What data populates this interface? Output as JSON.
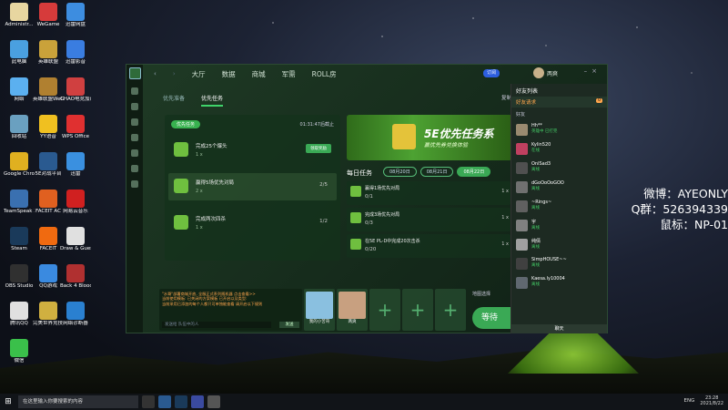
{
  "desktop_icons": [
    {
      "label": "Administr...",
      "color": "#e8d6a0"
    },
    {
      "label": "WeGame",
      "color": "#d63b3b"
    },
    {
      "label": "迅雷网盘",
      "color": "#3d8de0"
    },
    {
      "label": "此电脑",
      "color": "#4aa0e0"
    },
    {
      "label": "英雄联盟",
      "color": "#caa23a"
    },
    {
      "label": "迅雷影音",
      "color": "#3a7de0"
    },
    {
      "label": "网络",
      "color": "#5bb0f0"
    },
    {
      "label": "英雄联盟WeGame版",
      "color": "#b08030"
    },
    {
      "label": "CHAO电竞加速器",
      "color": "#d04040"
    },
    {
      "label": "回收站",
      "color": "#6aa0c0"
    },
    {
      "label": "YY语音",
      "color": "#f0c020"
    },
    {
      "label": "WPS Office",
      "color": "#e03030"
    },
    {
      "label": "Google Chrome",
      "color": "#e0b020"
    },
    {
      "label": "5E对战平台",
      "color": "#2a5a90"
    },
    {
      "label": "迅雷",
      "color": "#3a90e0"
    },
    {
      "label": "TeamSpeak 3",
      "color": "#3a70b0"
    },
    {
      "label": "FACEIT AC",
      "color": "#e06020"
    },
    {
      "label": "网易云音乐",
      "color": "#d02020"
    },
    {
      "label": "Steam",
      "color": "#1a3a5a"
    },
    {
      "label": "FACEIT",
      "color": "#f06a10"
    },
    {
      "label": "Draw & Guess",
      "color": "#e0e0e0"
    },
    {
      "label": "OBS Studio",
      "color": "#303030"
    },
    {
      "label": "QQ游戏",
      "color": "#3a8ae0"
    },
    {
      "label": "Back 4 Blood Beta",
      "color": "#b03030"
    },
    {
      "label": "腾讯QQ",
      "color": "#e0e0e0"
    },
    {
      "label": "完美世界竞技平台",
      "color": "#d0b040"
    },
    {
      "label": "网络诊断器",
      "color": "#2a80d0"
    },
    {
      "label": "微信",
      "color": "#3ac04a"
    }
  ],
  "app": {
    "nav": [
      "大厅",
      "数据",
      "商城",
      "军需",
      "ROLL房"
    ],
    "notify_btn": "订阅",
    "username": "两爽",
    "subtabs": [
      "优先准备",
      "优先任务"
    ],
    "copy_link": "复制房间",
    "priority": {
      "label": "优先任务",
      "deadline": "01:31:47后截止",
      "tasks": [
        {
          "name": "完成25个爆头",
          "reward": "1 x",
          "action": "领取奖励"
        },
        {
          "name": "赢得5场优先对局",
          "reward": "2 x",
          "progress": "2/5"
        },
        {
          "name": "完成两次四杀",
          "reward": "1 x",
          "progress": "1/2"
        }
      ]
    },
    "banner": {
      "title": "5E优先任务系",
      "subtitle": "赢优先券兑换体验"
    },
    "daily": {
      "title": "每日任务",
      "dates": [
        "08月20日",
        "08月21日",
        "08月22日"
      ],
      "tasks": [
        {
          "name": "赢得1场优先对局",
          "progress": "0/1",
          "mult": "1 x"
        },
        {
          "name": "完成3场优先对局",
          "progress": "0/3",
          "mult": "1 x"
        },
        {
          "name": "在5E PL-D中完成20次击杀",
          "progress": "0/20",
          "mult": "1 x"
        }
      ]
    },
    "chat": {
      "lines": [
        "\"水哥\"部署商城开放, 全服正式系列随机器 点击查看>>",
        "当前使用模板: 已关闭的方案模板 已开启以及类型:",
        "当前采用已添加的每个人都只可单独能查看 请开启以下规则"
      ],
      "placeholder": "发送给 队伍中的人",
      "send": "发送"
    },
    "players": [
      {
        "name": "我的小苦哥",
        "color": "#8ac0e0"
      },
      {
        "name": "两爽",
        "color": "#c8a080"
      }
    ],
    "mode_label": "地图选择",
    "start_btn": "等待"
  },
  "friends": {
    "title": "好友列表",
    "request": "好友请求",
    "request_count": "0",
    "group": "好友",
    "list": [
      {
        "name": "Hh**",
        "status": "英雄中 已打完",
        "color": "#9a8a70"
      },
      {
        "name": "Kylin520",
        "status": "在线",
        "color": "#c04060"
      },
      {
        "name": "OnlSad3",
        "status": "离线",
        "color": "#505050"
      },
      {
        "name": "dGoOoOoGOO",
        "status": "离线",
        "color": "#707070"
      },
      {
        "name": "~Rings~",
        "status": "离线",
        "color": "#606060"
      },
      {
        "name": "宇",
        "status": "离线",
        "color": "#808080"
      },
      {
        "name": "纯倩",
        "status": "离线",
        "color": "#a0a0a0"
      },
      {
        "name": "SimpHOUSE~~",
        "status": "离线",
        "color": "#404040"
      },
      {
        "name": "Kaesa.ly10004",
        "status": "离线",
        "color": "#606870"
      }
    ],
    "chat_btn": "聊天"
  },
  "overlay": [
    "微博：AYEONLY",
    "Q群：526394339",
    "鼠标：NP-01"
  ],
  "taskbar": {
    "search": "在这里输入你要搜索的内容",
    "lang": "ENG",
    "time": "23:28",
    "date": "2021/8/22"
  }
}
